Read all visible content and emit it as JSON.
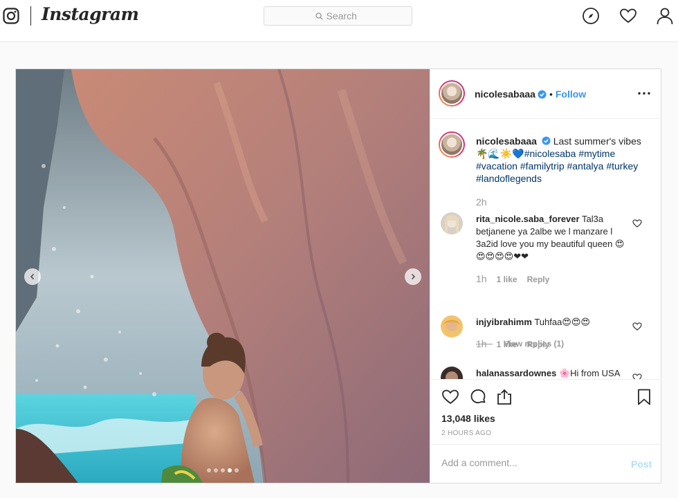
{
  "nav": {
    "logo_icon": "instagram-glyph-icon",
    "wordmark": "Instagram",
    "search_placeholder": "Search",
    "icons": [
      "compass-icon",
      "heart-icon",
      "profile-icon"
    ]
  },
  "post": {
    "image_alt": "Photo by nicolesabaaa",
    "carousel": {
      "slide_count": 5,
      "active_slide": 4
    },
    "header": {
      "username": "nicolesabaaa",
      "verified": true,
      "separator": "•",
      "follow_label": "Follow",
      "more_icon": "more-options-icon"
    },
    "caption": {
      "username": "nicolesabaaa",
      "text": "Last summer's vibes",
      "emojis": "🌴🌊☀️💙",
      "hashtags": [
        "#nicolesaba",
        "#mytime",
        "#vacation",
        "#familytrip",
        "#antalya",
        "#turkey",
        "#landoflegends"
      ],
      "time": "2h"
    },
    "comments": [
      {
        "username": "rita_nicole.saba_forever",
        "text": "Tal3a betjanene ya 2albe we l manzare l 3a2id love you my beautiful queen 😍😍😍😍😍❤❤",
        "time": "1h",
        "likes": "1 like",
        "reply_label": "Reply",
        "view_replies": "View replies (1)"
      },
      {
        "username": "injyibrahimm",
        "text": "Tuhfaa😍😍😍",
        "time": "1h",
        "likes": "1 like",
        "reply_label": "Reply"
      },
      {
        "username": "halanassardownes",
        "text": "🌸Hi from USA"
      }
    ],
    "actions": {
      "icons": [
        "like-icon",
        "comment-icon",
        "share-icon",
        "save-icon"
      ]
    },
    "likes": "13,048 likes",
    "timestamp": "2 HOURS AGO",
    "add_comment": {
      "placeholder": "Add a comment...",
      "post_label": "Post"
    }
  },
  "colors": {
    "link_blue": "#3897f0",
    "hashtag": "#003569",
    "muted": "#999999",
    "border": "#dbdbdb",
    "post_disabled": "#b2dffc"
  }
}
